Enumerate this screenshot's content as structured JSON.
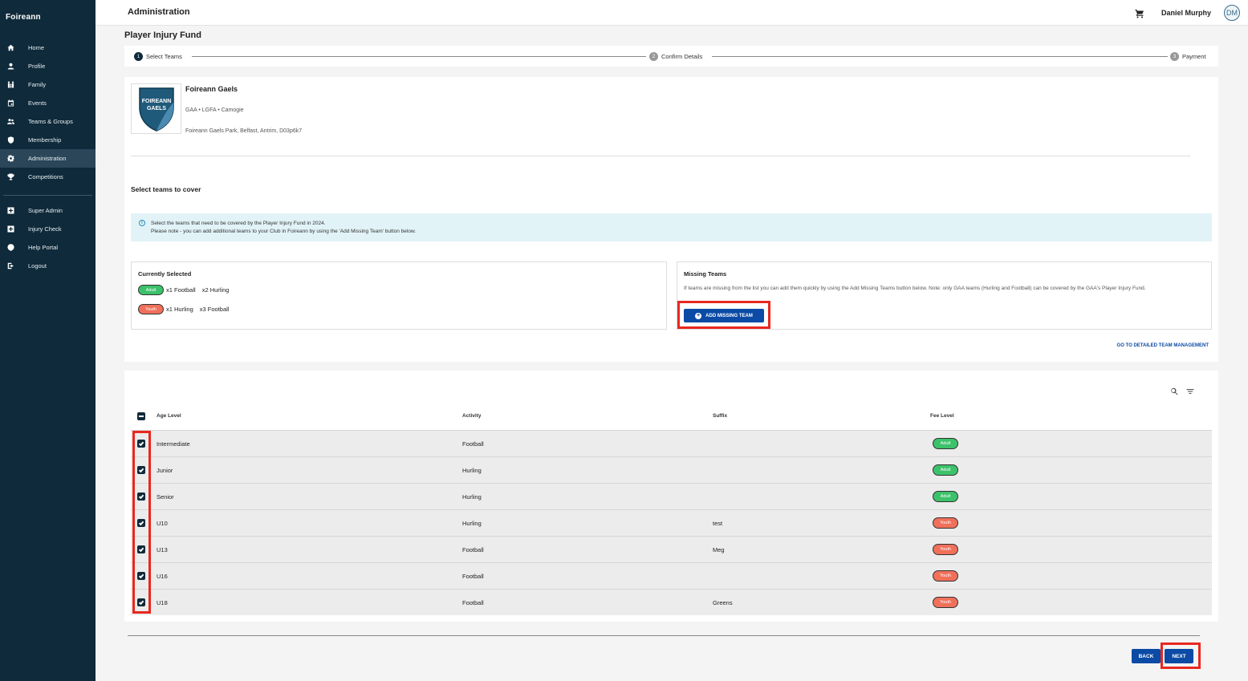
{
  "sidebar": {
    "brand": "Foireann",
    "items": [
      {
        "label": "Home",
        "icon": "home-icon"
      },
      {
        "label": "Profile",
        "icon": "person-icon"
      },
      {
        "label": "Family",
        "icon": "family-icon"
      },
      {
        "label": "Events",
        "icon": "calendar-icon"
      },
      {
        "label": "Teams & Groups",
        "icon": "group-icon"
      },
      {
        "label": "Membership",
        "icon": "shield-icon"
      },
      {
        "label": "Administration",
        "icon": "gear-icon",
        "active": true
      },
      {
        "label": "Competitions",
        "icon": "trophy-icon"
      }
    ],
    "secondary_items": [
      {
        "label": "Super Admin",
        "icon": "plus-box-icon"
      },
      {
        "label": "Injury Check",
        "icon": "plus-box-icon"
      },
      {
        "label": "Help Portal",
        "icon": "help-icon"
      },
      {
        "label": "Logout",
        "icon": "logout-icon"
      }
    ]
  },
  "header": {
    "title": "Administration",
    "user_name": "Daniel Murphy",
    "avatar_initials": "DM"
  },
  "page": {
    "title": "Player Injury Fund"
  },
  "stepper": {
    "steps": [
      {
        "number": "1",
        "label": "Select Teams",
        "active": true
      },
      {
        "number": "2",
        "label": "Confirm Details",
        "active": false
      },
      {
        "number": "3",
        "label": "Payment",
        "active": false
      }
    ]
  },
  "club": {
    "logo_text_1": "FOIREANN",
    "logo_text_2": "GAELS",
    "name": "Foireann Gaels",
    "sports": "GAA • LGFA • Camogie",
    "address": "Foireann Gaels Park, Belfast, Antrim, D03p6k7"
  },
  "select_section": {
    "title": "Select teams to cover",
    "info_line1": "Select the teams that need to be covered by the Player Injury Fund in 2024.",
    "info_line2": "Please note - you can add additional teams to your Club in Foireann by using the 'Add Missing Team' button below."
  },
  "currently_selected": {
    "title": "Currently Selected",
    "rows": [
      {
        "level": "Adult",
        "items": [
          "x1 Football",
          "x2 Hurling"
        ]
      },
      {
        "level": "Youth",
        "items": [
          "x1 Hurling",
          "x3 Football"
        ]
      }
    ]
  },
  "missing_teams": {
    "title": "Missing Teams",
    "description": "If teams are missing from the list you can add them quickly by using the Add Missing Teams button below. Note: only GAA teams (Hurling and Football) can be covered by the GAA's Player Injury Fund.",
    "button_label": "ADD MISSING TEAM"
  },
  "detail_link": "GO TO DETAILED TEAM MANAGEMENT",
  "table": {
    "columns": [
      "Age Level",
      "Activity",
      "Suffix",
      "Fee Level"
    ],
    "rows": [
      {
        "age": "Intermediate",
        "activity": "Football",
        "suffix": "",
        "fee": "Adult",
        "checked": true
      },
      {
        "age": "Junior",
        "activity": "Hurling",
        "suffix": "",
        "fee": "Adult",
        "checked": true
      },
      {
        "age": "Senior",
        "activity": "Hurling",
        "suffix": "",
        "fee": "Adult",
        "checked": true
      },
      {
        "age": "U10",
        "activity": "Hurling",
        "suffix": "test",
        "fee": "Youth",
        "checked": true
      },
      {
        "age": "U13",
        "activity": "Football",
        "suffix": "Meg",
        "fee": "Youth",
        "checked": true
      },
      {
        "age": "U16",
        "activity": "Football",
        "suffix": "",
        "fee": "Youth",
        "checked": true
      },
      {
        "age": "U18",
        "activity": "Football",
        "suffix": "Greens",
        "fee": "Youth",
        "checked": true
      }
    ]
  },
  "footer": {
    "back_label": "BACK",
    "next_label": "NEXT"
  },
  "colors": {
    "sidebar_bg": "#0f2a3a",
    "primary_button": "#0b4aa5",
    "adult_pill": "#3cc26a",
    "youth_pill": "#f0705a",
    "highlight_box": "#e8281f"
  }
}
